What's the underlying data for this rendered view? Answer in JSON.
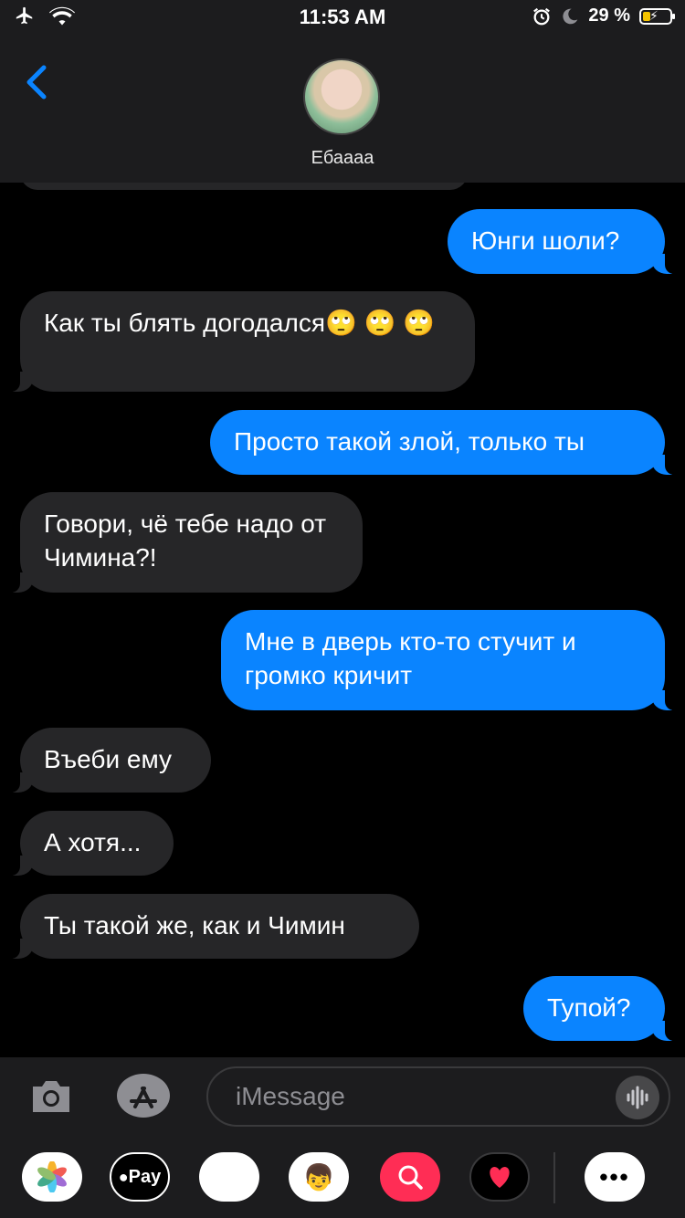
{
  "status": {
    "time": "11:53 AM",
    "battery": "29 %",
    "battery_fill": 0.29
  },
  "header": {
    "contact_name": "Ебаааа"
  },
  "messages": [
    {
      "side": "sent",
      "text": "Юнги шоли?"
    },
    {
      "side": "recv",
      "text": "Как ты блять догодался🙄 🙄 🙄"
    },
    {
      "side": "sent",
      "text": "Просто такой злой, только ты"
    },
    {
      "side": "recv",
      "text": "Говори, чё тебе надо от Чимина?!"
    },
    {
      "side": "sent",
      "text": "Мне в дверь кто-то стучит и громко кричит"
    },
    {
      "side": "recv",
      "text": "Въеби ему"
    },
    {
      "side": "recv",
      "text": "А хотя..."
    },
    {
      "side": "recv",
      "text": "Ты такой же, как и Чимин"
    },
    {
      "side": "sent",
      "text": "Тупой?"
    }
  ],
  "composer": {
    "placeholder": "iMessage"
  },
  "apps": [
    {
      "name": "photos-icon"
    },
    {
      "name": "apple-pay-icon",
      "label": "Pay"
    },
    {
      "name": "animoji-icon"
    },
    {
      "name": "memoji-icon"
    },
    {
      "name": "web-search-icon"
    },
    {
      "name": "digital-touch-icon"
    },
    {
      "name": "more-apps-icon"
    }
  ],
  "colors": {
    "sent": "#0a84ff",
    "received": "#262628",
    "bar": "#1c1c1e"
  }
}
